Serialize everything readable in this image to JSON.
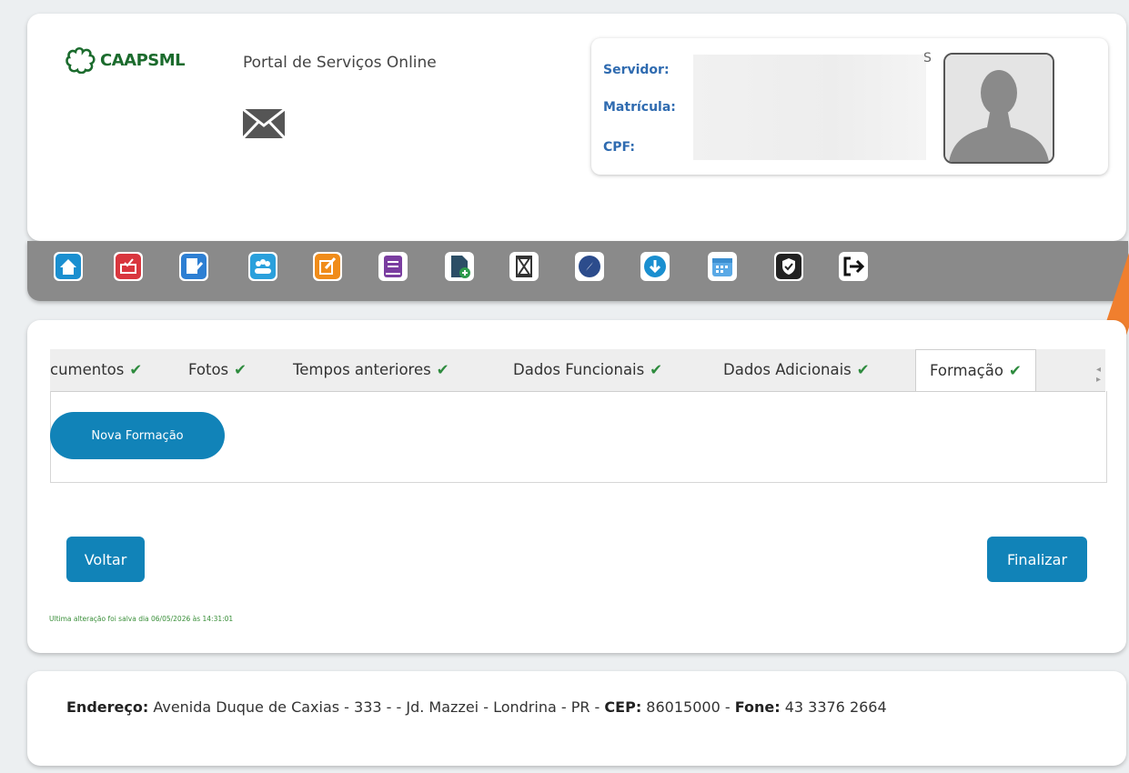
{
  "header": {
    "logo_text": "CAAPSML",
    "portal_title": "Portal de Serviços Online",
    "mail_icon": "envelope-icon"
  },
  "user": {
    "servidor_label": "Servidor:",
    "matricula_label": "Matrícula:",
    "cpf_label": "CPF:",
    "servidor_value_tail": "S",
    "avatar": "user-silhouette"
  },
  "toolbar": {
    "icons": [
      {
        "name": "home-icon",
        "color": "#1a8fd0"
      },
      {
        "name": "inbox-icon",
        "color": "#d9363e"
      },
      {
        "name": "edit-document-icon",
        "color": "#2d7fd3"
      },
      {
        "name": "users-icon",
        "color": "#2aa0dc"
      },
      {
        "name": "pencil-square-icon",
        "color": "#f08c1a"
      },
      {
        "name": "book-icon",
        "color": "#7a3da0"
      },
      {
        "name": "file-add-icon",
        "color": "#2c4e66"
      },
      {
        "name": "hourglass-icon",
        "color": "#333333"
      },
      {
        "name": "compass-icon",
        "color": "#2c4c8c"
      },
      {
        "name": "download-icon",
        "color": "#1a8fd0"
      },
      {
        "name": "calendar-icon",
        "color": "#5aa9e6"
      },
      {
        "name": "shield-check-icon",
        "color": "#222222"
      },
      {
        "name": "logout-icon",
        "color": "#111111"
      }
    ]
  },
  "tabs": [
    {
      "label": "cumentos",
      "check": "✔"
    },
    {
      "label": "Fotos",
      "check": "✔"
    },
    {
      "label": "Tempos anteriores",
      "check": "✔"
    },
    {
      "label": "Dados Funcionais",
      "check": "✔"
    },
    {
      "label": "Dados Adicionais",
      "check": "✔"
    },
    {
      "label": "Formação",
      "check": "✔",
      "active": true
    }
  ],
  "tab_arrows": "◂ ▸",
  "content": {
    "new_button": "Nova Formação",
    "back_button": "Voltar",
    "finish_button": "Finalizar",
    "saved_note": "Ultima alteração foi salva dia 06/05/2026 às 14:31:01"
  },
  "footer": {
    "address_label": "Endereço:",
    "address_value": " Avenida Duque de Caxias - 333 - - Jd. Mazzei - Londrina - PR - ",
    "cep_label": "CEP:",
    "cep_value": " 86015000 - ",
    "phone_label": "Fone:",
    "phone_value": " 43 3376 2664"
  },
  "colors": {
    "accent": "#1183b8",
    "toolbar": "#8a8a8a",
    "check": "#2e8b3e",
    "label_blue": "#2f6bb0",
    "annotation": "#f07f2e"
  }
}
